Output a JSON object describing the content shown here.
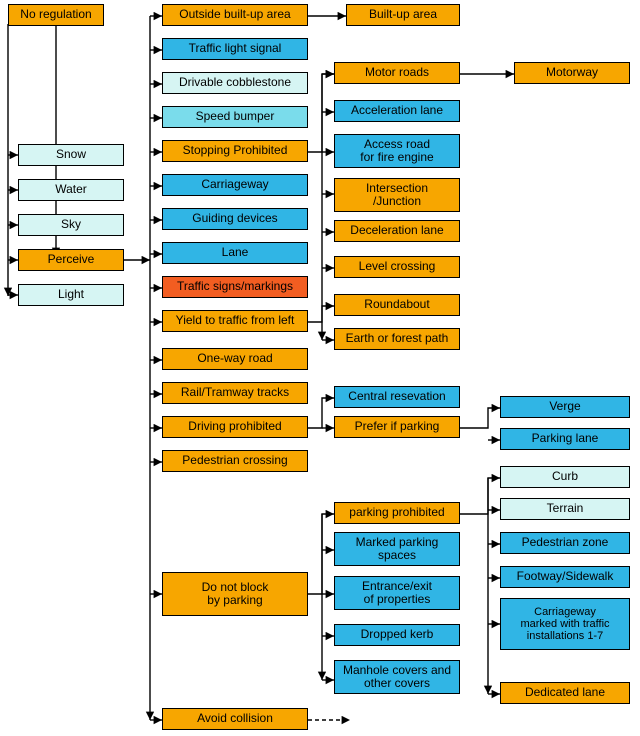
{
  "chart_data": {
    "type": "flow-diagram",
    "columns": {
      "root": [
        {
          "label": "No regulation",
          "color": "amber"
        },
        {
          "label": "Snow",
          "color": "light-cyan"
        },
        {
          "label": "Water",
          "color": "light-cyan"
        },
        {
          "label": "Sky",
          "color": "light-cyan"
        },
        {
          "label": "Perceive",
          "color": "amber"
        },
        {
          "label": "Light",
          "color": "light-cyan"
        }
      ],
      "col2": [
        {
          "label": "Outside built-up area",
          "color": "amber"
        },
        {
          "label": "Traffic light signal",
          "color": "sat-cyan"
        },
        {
          "label": "Drivable cobblestone",
          "color": "light-cyan"
        },
        {
          "label": "Speed bumper",
          "color": "mid-cyan"
        },
        {
          "label": "Stopping Prohibited",
          "color": "amber"
        },
        {
          "label": "Carriageway",
          "color": "sat-cyan"
        },
        {
          "label": "Guiding devices",
          "color": "sat-cyan"
        },
        {
          "label": "Lane",
          "color": "sat-cyan"
        },
        {
          "label": "Traffic signs/markings",
          "color": "red-orange"
        },
        {
          "label": "Yield to traffic from left",
          "color": "amber"
        },
        {
          "label": "One-way road",
          "color": "amber"
        },
        {
          "label": "Rail/Tramway tracks",
          "color": "amber"
        },
        {
          "label": "Driving prohibited",
          "color": "amber"
        },
        {
          "label": "Pedestrian crossing",
          "color": "amber"
        },
        {
          "label": "Do not block by parking",
          "color": "amber"
        },
        {
          "label": "Avoid collision",
          "color": "amber"
        }
      ],
      "col3": [
        {
          "label": "Built-up area",
          "color": "amber"
        },
        {
          "label": "Motor roads",
          "color": "amber"
        },
        {
          "label": "Acceleration lane",
          "color": "sat-cyan"
        },
        {
          "label": "Access road for fire engine",
          "color": "sat-cyan"
        },
        {
          "label": "Intersection /Junction",
          "color": "amber"
        },
        {
          "label": "Deceleration lane",
          "color": "amber"
        },
        {
          "label": "Level crossing",
          "color": "amber"
        },
        {
          "label": "Roundabout",
          "color": "amber"
        },
        {
          "label": "Earth or forest path",
          "color": "amber"
        },
        {
          "label": "Central resevation",
          "color": "sat-cyan"
        },
        {
          "label": "Prefer if parking",
          "color": "amber"
        },
        {
          "label": "parking prohibited",
          "color": "amber"
        },
        {
          "label": "Marked parking spaces",
          "color": "sat-cyan"
        },
        {
          "label": "Entrance/exit of properties",
          "color": "sat-cyan"
        },
        {
          "label": "Dropped kerb",
          "color": "sat-cyan"
        },
        {
          "label": "Manhole covers and other covers",
          "color": "sat-cyan"
        }
      ],
      "col4": [
        {
          "label": "Motorway",
          "color": "amber"
        },
        {
          "label": "Verge",
          "color": "sat-cyan"
        },
        {
          "label": "Parking lane",
          "color": "sat-cyan"
        },
        {
          "label": "Curb",
          "color": "light-cyan"
        },
        {
          "label": "Terrain",
          "color": "light-cyan"
        },
        {
          "label": "Pedestrian zone",
          "color": "sat-cyan"
        },
        {
          "label": "Footway/Sidewalk",
          "color": "sat-cyan"
        },
        {
          "label": "Carriageway marked with traffic installations 1-7",
          "color": "sat-cyan"
        },
        {
          "label": "Dedicated lane",
          "color": "amber"
        }
      ]
    },
    "edges_note": "Arrows flow left→right between adjacent columns; root 'No regulation' feeds into column 2; 'Perceive' feeds column 1 siblings and column 2; column-2 nodes feed relevant column-3 nodes; column-3 to column-4 as laid out."
  },
  "nodes": {
    "noReg": "No regulation",
    "snow": "Snow",
    "water": "Water",
    "sky": "Sky",
    "perceive": "Perceive",
    "light": "Light",
    "outside": "Outside built-up area",
    "tls": "Traffic light signal",
    "cobble": "Drivable cobblestone",
    "bumper": "Speed bumper",
    "stopping": "Stopping Prohibited",
    "carriage": "Carriageway",
    "guiding": "Guiding devices",
    "lane": "Lane",
    "signs": "Traffic signs/markings",
    "yield": "Yield to traffic from left",
    "oneway": "One-way road",
    "rail": "Rail/Tramway tracks",
    "drvproh": "Driving prohibited",
    "pedx": "Pedestrian crossing",
    "noblock": "Do not block\nby parking",
    "avoid": "Avoid collision",
    "builtup": "Built-up area",
    "motorR": "Motor roads",
    "accel": "Acceleration lane",
    "fire": "Access road\nfor fire engine",
    "inter": "Intersection\n/Junction",
    "decel": "Deceleration lane",
    "levelx": "Level crossing",
    "round": "Roundabout",
    "forest": "Earth or forest path",
    "central": "Central resevation",
    "prefer": "Prefer if parking",
    "pkproh": "parking prohibited",
    "mps": "Marked parking\nspaces",
    "entr": "Entrance/exit\nof properties",
    "dkerb": "Dropped kerb",
    "manhole": "Manhole covers and\nother covers",
    "motorway": "Motorway",
    "verge": "Verge",
    "plane": "Parking lane",
    "curb": "Curb",
    "terrain": "Terrain",
    "pzone": "Pedestrian zone",
    "footway": "Footway/Sidewalk",
    "cmwti": "Carriageway\nmarked with traffic\ninstallations 1-7",
    "dlane": "Dedicated lane"
  }
}
